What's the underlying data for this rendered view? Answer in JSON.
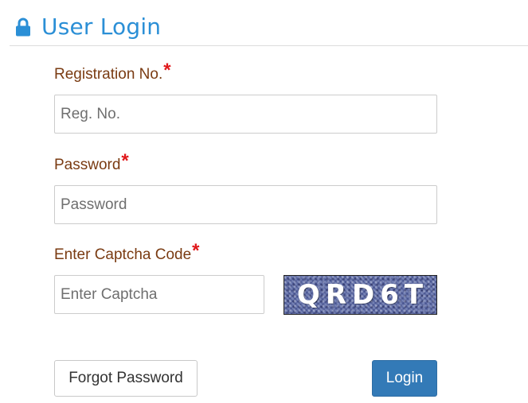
{
  "header": {
    "title": "User Login",
    "icon": "lock-icon",
    "accent_color": "#2b8fd6"
  },
  "form": {
    "registration": {
      "label": "Registration No.",
      "required_mark": "*",
      "placeholder": "Reg. No.",
      "value": ""
    },
    "password": {
      "label": "Password",
      "required_mark": "*",
      "placeholder": "Password",
      "value": ""
    },
    "captcha": {
      "label": "Enter Captcha Code",
      "required_mark": "*",
      "placeholder": "Enter Captcha",
      "value": "",
      "image_text": "QRD6T"
    }
  },
  "buttons": {
    "forgot_password": "Forgot Password",
    "login": "Login",
    "login_color": "#337ab7"
  },
  "colors": {
    "label": "#7a3b12",
    "required": "#e0181b"
  }
}
